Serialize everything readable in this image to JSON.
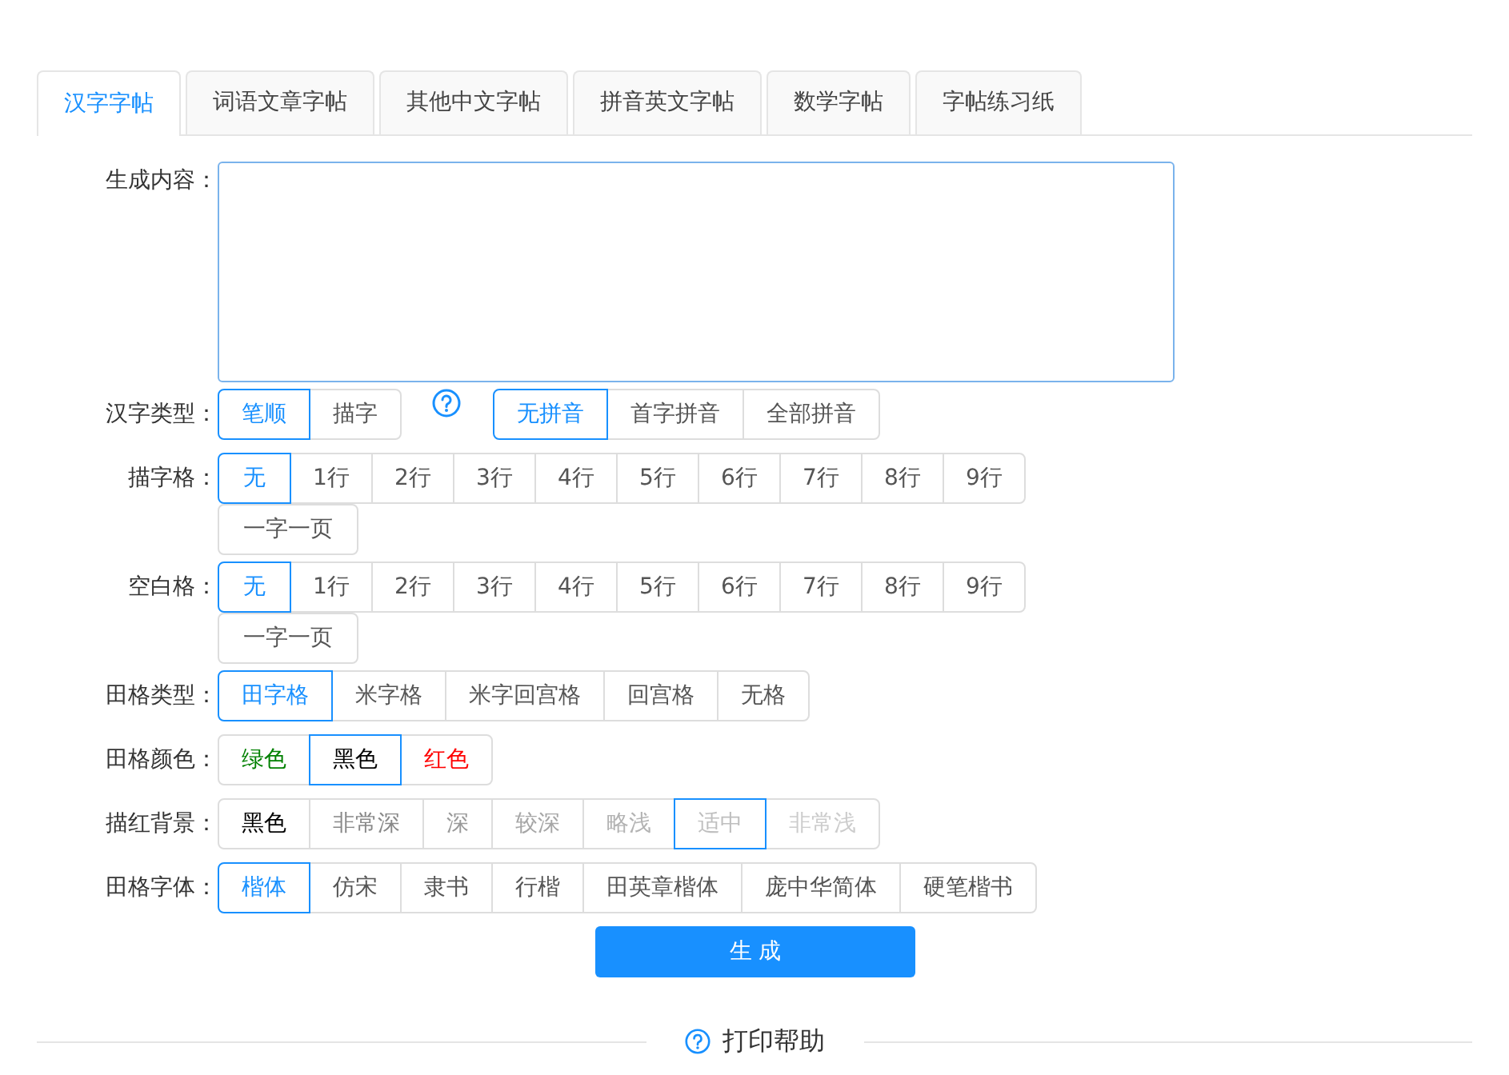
{
  "tabs": [
    {
      "label": "汉字字帖",
      "selected": true
    },
    {
      "label": "词语文章字帖",
      "selected": false
    },
    {
      "label": "其他中文字帖",
      "selected": false
    },
    {
      "label": "拼音英文字帖",
      "selected": false
    },
    {
      "label": "数学字帖",
      "selected": false
    },
    {
      "label": "字帖练习纸",
      "selected": false
    }
  ],
  "form": [
    {
      "kind": "textarea",
      "label": "生成内容："
    },
    {
      "kind": "options",
      "label": "汉字类型：",
      "help": true,
      "groups": [
        [
          {
            "label": "笔顺",
            "selected": true
          },
          {
            "label": "描字",
            "selected": false
          }
        ],
        [
          {
            "label": "无拼音",
            "selected": true
          },
          {
            "label": "首字拼音",
            "selected": false
          },
          {
            "label": "全部拼音",
            "selected": false
          }
        ]
      ]
    },
    {
      "kind": "options",
      "label": "描字格：",
      "groups": [
        [
          {
            "label": "无",
            "selected": true
          },
          {
            "label": "1行",
            "selected": false
          },
          {
            "label": "2行",
            "selected": false
          },
          {
            "label": "3行",
            "selected": false
          },
          {
            "label": "4行",
            "selected": false
          },
          {
            "label": "5行",
            "selected": false
          },
          {
            "label": "6行",
            "selected": false
          },
          {
            "label": "7行",
            "selected": false
          },
          {
            "label": "8行",
            "selected": false
          },
          {
            "label": "9行",
            "selected": false
          },
          {
            "label": "一字一页",
            "selected": false
          }
        ]
      ]
    },
    {
      "kind": "options",
      "label": "空白格：",
      "groups": [
        [
          {
            "label": "无",
            "selected": true
          },
          {
            "label": "1行",
            "selected": false
          },
          {
            "label": "2行",
            "selected": false
          },
          {
            "label": "3行",
            "selected": false
          },
          {
            "label": "4行",
            "selected": false
          },
          {
            "label": "5行",
            "selected": false
          },
          {
            "label": "6行",
            "selected": false
          },
          {
            "label": "7行",
            "selected": false
          },
          {
            "label": "8行",
            "selected": false
          },
          {
            "label": "9行",
            "selected": false
          },
          {
            "label": "一字一页",
            "selected": false
          }
        ]
      ]
    },
    {
      "kind": "options",
      "label": "田格类型：",
      "groups": [
        [
          {
            "label": "田字格",
            "selected": true
          },
          {
            "label": "米字格",
            "selected": false
          },
          {
            "label": "米字回宫格",
            "selected": false
          },
          {
            "label": "回宫格",
            "selected": false
          },
          {
            "label": "无格",
            "selected": false
          }
        ]
      ]
    },
    {
      "kind": "options",
      "label": "田格颜色：",
      "groups": [
        [
          {
            "label": "绿色",
            "selected": false,
            "color": "#008000"
          },
          {
            "label": "黑色",
            "selected": true,
            "color": "#000000"
          },
          {
            "label": "红色",
            "selected": false,
            "color": "#ff0000"
          }
        ]
      ]
    },
    {
      "kind": "options",
      "label": "描红背景：",
      "groups": [
        [
          {
            "label": "黑色",
            "selected": false,
            "color": "#000000"
          },
          {
            "label": "非常深",
            "selected": false,
            "color": "#888888"
          },
          {
            "label": "深",
            "selected": false,
            "color": "#999999"
          },
          {
            "label": "较深",
            "selected": false,
            "color": "#a6a6a6"
          },
          {
            "label": "略浅",
            "selected": false,
            "color": "#b3b3b3"
          },
          {
            "label": "适中",
            "selected": true,
            "color": "#bfbfbf"
          },
          {
            "label": "非常浅",
            "selected": false,
            "color": "#cccccc"
          }
        ]
      ]
    },
    {
      "kind": "options",
      "label": "田格字体：",
      "groups": [
        [
          {
            "label": "楷体",
            "selected": true
          },
          {
            "label": "仿宋",
            "selected": false
          },
          {
            "label": "隶书",
            "selected": false
          },
          {
            "label": "行楷",
            "selected": false
          },
          {
            "label": "田英章楷体",
            "selected": false
          },
          {
            "label": "庞中华简体",
            "selected": false
          },
          {
            "label": "硬笔楷书",
            "selected": false
          }
        ]
      ]
    }
  ],
  "submit": "生 成",
  "help_link": "打印帮助"
}
